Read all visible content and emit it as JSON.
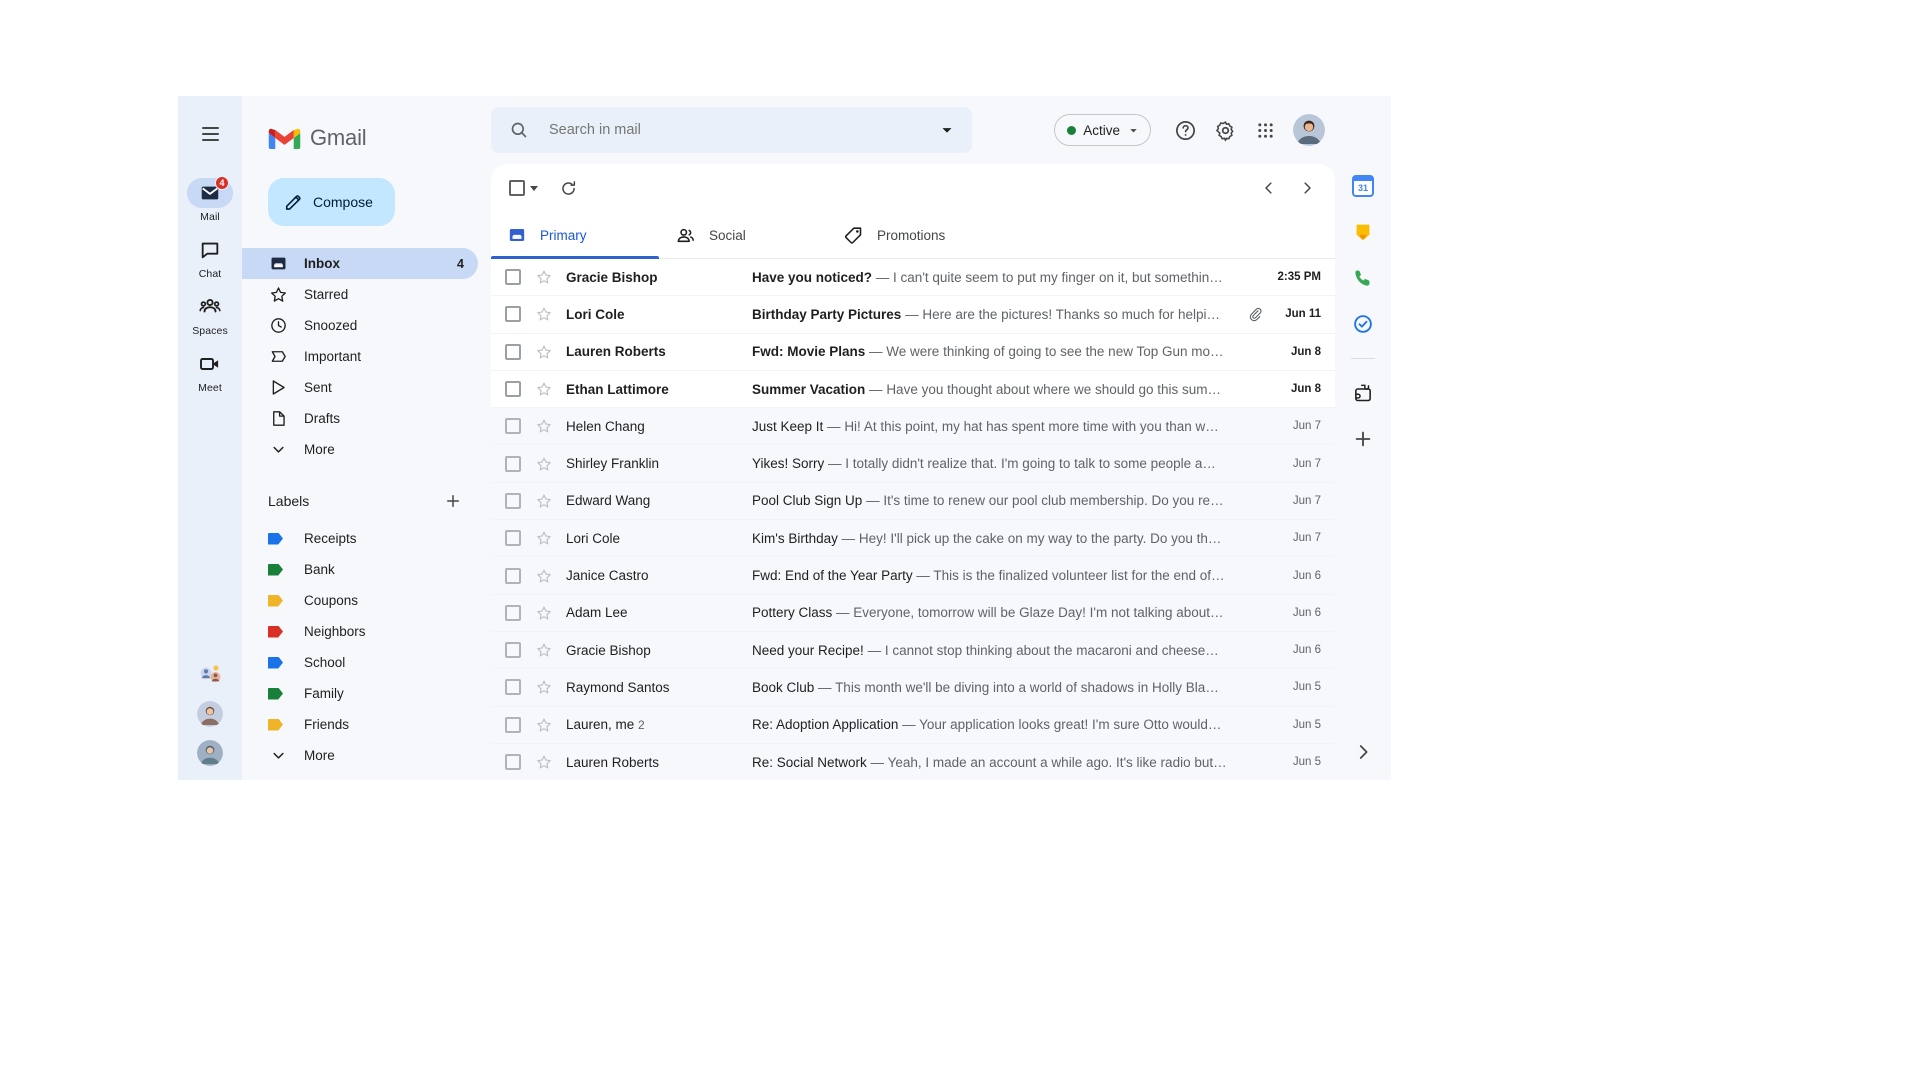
{
  "app": {
    "brand_name": "Gmail",
    "hamburger_name": "main-menu"
  },
  "rail": {
    "items": [
      {
        "label": "Mail",
        "icon": "mail-icon",
        "badge": "4",
        "active": true
      },
      {
        "label": "Chat",
        "icon": "chat-icon",
        "badge": "",
        "active": false
      },
      {
        "label": "Spaces",
        "icon": "spaces-icon",
        "badge": "",
        "active": false
      },
      {
        "label": "Meet",
        "icon": "meet-icon",
        "badge": "",
        "active": false
      }
    ]
  },
  "sidebar": {
    "compose_label": "Compose",
    "nav": [
      {
        "label": "Inbox",
        "icon": "inbox-icon",
        "count": "4",
        "active": true
      },
      {
        "label": "Starred",
        "icon": "star-icon",
        "count": "",
        "active": false
      },
      {
        "label": "Snoozed",
        "icon": "clock-icon",
        "count": "",
        "active": false
      },
      {
        "label": "Important",
        "icon": "important-icon",
        "count": "",
        "active": false
      },
      {
        "label": "Sent",
        "icon": "send-icon",
        "count": "",
        "active": false
      },
      {
        "label": "Drafts",
        "icon": "draft-icon",
        "count": "",
        "active": false
      },
      {
        "label": "More",
        "icon": "chevron-down-icon",
        "count": "",
        "active": false
      }
    ],
    "labels_title": "Labels",
    "labels": [
      {
        "name": "Receipts",
        "color": "#1a73e8"
      },
      {
        "name": "Bank",
        "color": "#188038"
      },
      {
        "name": "Coupons",
        "color": "#f0b429"
      },
      {
        "name": "Neighbors",
        "color": "#d93025"
      },
      {
        "name": "School",
        "color": "#1a73e8"
      },
      {
        "name": "Family",
        "color": "#188038"
      },
      {
        "name": "Friends",
        "color": "#f0b429"
      }
    ],
    "labels_more": "More"
  },
  "search": {
    "placeholder": "Search in mail",
    "value": ""
  },
  "header": {
    "status_label": "Active",
    "status_color": "#188038",
    "help_icon": "help-icon",
    "settings_icon": "gear-icon",
    "apps_icon": "apps-grid-icon"
  },
  "toolbar": {
    "select_all_name": "select-all-checkbox",
    "refresh_name": "refresh-button",
    "prev_name": "newer-page-button",
    "next_name": "older-page-button"
  },
  "tabs": [
    {
      "label": "Primary",
      "icon": "inbox-tab-icon",
      "active": true
    },
    {
      "label": "Social",
      "icon": "social-people-icon",
      "active": false
    },
    {
      "label": "Promotions",
      "icon": "promotions-tag-icon",
      "active": false
    }
  ],
  "emails": [
    {
      "sender": "Gracie Bishop",
      "count": "",
      "subject": "Have you noticed?",
      "snippet": "I can't quite seem to put my finger on it, but somethin…",
      "date": "2:35 PM",
      "unread": true,
      "attachment": false
    },
    {
      "sender": "Lori Cole",
      "count": "",
      "subject": "Birthday Party Pictures",
      "snippet": "Here are the pictures! Thanks so much for helpi…",
      "date": "Jun 11",
      "unread": true,
      "attachment": true
    },
    {
      "sender": "Lauren Roberts",
      "count": "",
      "subject": "Fwd: Movie Plans",
      "snippet": "We were thinking of going to see the new Top Gun mo…",
      "date": "Jun 8",
      "unread": true,
      "attachment": false
    },
    {
      "sender": "Ethan Lattimore",
      "count": "",
      "subject": "Summer Vacation",
      "snippet": "Have you thought about where we should go this sum…",
      "date": "Jun 8",
      "unread": true,
      "attachment": false
    },
    {
      "sender": "Helen Chang",
      "count": "",
      "subject": "Just Keep It",
      "snippet": "Hi! At this point, my hat has spent more time with you than w…",
      "date": "Jun 7",
      "unread": false,
      "attachment": false
    },
    {
      "sender": "Shirley Franklin",
      "count": "",
      "subject": "Yikes! Sorry",
      "snippet": "I totally didn't realize that. I'm going to talk to some people a…",
      "date": "Jun 7",
      "unread": false,
      "attachment": false
    },
    {
      "sender": "Edward Wang",
      "count": "",
      "subject": "Pool Club Sign Up",
      "snippet": "It's time to renew our pool club membership. Do you re…",
      "date": "Jun 7",
      "unread": false,
      "attachment": false
    },
    {
      "sender": "Lori Cole",
      "count": "",
      "subject": "Kim's Birthday",
      "snippet": "Hey! I'll pick up the cake on my way to the party. Do you th…",
      "date": "Jun 7",
      "unread": false,
      "attachment": false
    },
    {
      "sender": "Janice Castro",
      "count": "",
      "subject": "Fwd: End of the Year Party",
      "snippet": "This is the finalized volunteer list for the end of…",
      "date": "Jun 6",
      "unread": false,
      "attachment": false
    },
    {
      "sender": "Adam Lee",
      "count": "",
      "subject": "Pottery Class",
      "snippet": "Everyone, tomorrow will be Glaze Day! I'm not talking about…",
      "date": "Jun 6",
      "unread": false,
      "attachment": false
    },
    {
      "sender": "Gracie Bishop",
      "count": "",
      "subject": "Need your Recipe!",
      "snippet": "I cannot stop thinking about the macaroni and cheese…",
      "date": "Jun 6",
      "unread": false,
      "attachment": false
    },
    {
      "sender": "Raymond Santos",
      "count": "",
      "subject": "Book Club",
      "snippet": "This month we'll be diving into a world of shadows in Holly Bla…",
      "date": "Jun 5",
      "unread": false,
      "attachment": false
    },
    {
      "sender": "Lauren, me",
      "count": "2",
      "subject": "Re: Adoption Application",
      "snippet": "Your application looks great! I'm sure Otto would…",
      "date": "Jun 5",
      "unread": false,
      "attachment": false
    },
    {
      "sender": "Lauren Roberts",
      "count": "",
      "subject": "Re: Social Network",
      "snippet": "Yeah, I made an account a while ago. It's like radio but…",
      "date": "Jun 5",
      "unread": false,
      "attachment": false
    }
  ],
  "side_rail": {
    "calendar_day": "31",
    "items": [
      {
        "icon": "calendar-icon"
      },
      {
        "icon": "keep-notes-icon"
      },
      {
        "icon": "contacts-phone-icon"
      },
      {
        "icon": "tasks-icon"
      },
      {
        "icon": "addons-icon"
      },
      {
        "icon": "add-addon-icon"
      }
    ],
    "expand_icon": "chevron-right-icon"
  }
}
